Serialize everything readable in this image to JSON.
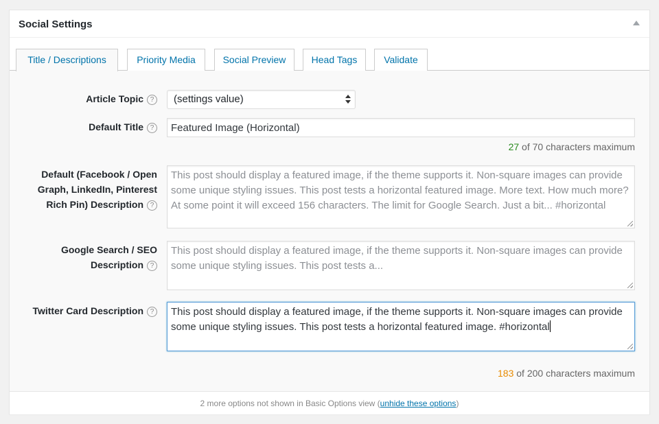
{
  "panel": {
    "title": "Social Settings"
  },
  "tabs": [
    {
      "label": "Title / Descriptions",
      "active": true
    },
    {
      "label": "Priority Media",
      "active": false
    },
    {
      "label": "Social Preview",
      "active": false
    },
    {
      "label": "Head Tags",
      "active": false
    },
    {
      "label": "Validate",
      "active": false
    }
  ],
  "help_glyph": "?",
  "fields": {
    "article_topic": {
      "label": "Article Topic",
      "value": "(settings value)"
    },
    "default_title": {
      "label": "Default Title",
      "value": "Featured Image (Horizontal)",
      "count": "27",
      "count_suffix": "of 70 characters maximum"
    },
    "og_description": {
      "label_line1": "Default (Facebook / Open",
      "label_line2": "Graph, LinkedIn, Pinterest",
      "label_line3": "Rich Pin) Description",
      "placeholder": "This post should display a featured image, if the theme supports it. Non-square images can provide some unique styling issues. This post tests a horizontal featured image. More text. How much more? At some point it will exceed 156 characters. The limit for Google Search. Just a bit... #horizontal"
    },
    "seo_description": {
      "label_line1": "Google Search / SEO",
      "label_line2": "Description",
      "placeholder": "This post should display a featured image, if the theme supports it. Non-square images can provide some unique styling issues. This post tests a..."
    },
    "twitter_description": {
      "label": "Twitter Card Description",
      "value": "This post should display a featured image, if the theme supports it. Non-square images can provide some unique styling issues. This post tests a horizontal featured image. #horizontal",
      "count": "183",
      "count_suffix": "of 200 characters maximum"
    }
  },
  "footer": {
    "text": "2 more options not shown in Basic Options view (",
    "link": "unhide these options",
    "text_end": ")"
  },
  "colors": {
    "link": "#0073aa",
    "count_ok": "#2a8a1f",
    "count_warn": "#e88b00",
    "focus_border": "#5b9dd9"
  }
}
